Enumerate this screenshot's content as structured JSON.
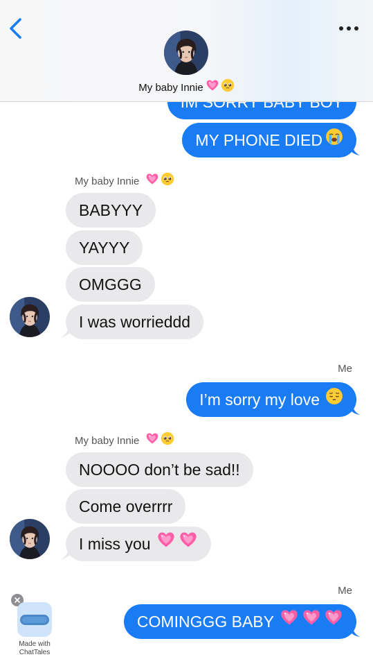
{
  "header": {
    "contact_name": "My baby Innie",
    "back_icon": "chevron-left-icon",
    "more_icon": "more-dots-icon"
  },
  "messages": [
    {
      "id": "m1",
      "side": "out",
      "text": "IM SORRY BABY BOY",
      "emojis": []
    },
    {
      "id": "m2",
      "side": "out",
      "text": "MY PHONE DIED",
      "emojis": [
        "crying-face-emoji"
      ]
    },
    {
      "id": "n1",
      "sender": "My baby Innie",
      "emojis": [
        "pink-heart-emoji",
        "pleading-face-emoji"
      ]
    },
    {
      "id": "m3",
      "side": "in",
      "text": "BABYYY"
    },
    {
      "id": "m4",
      "side": "in",
      "text": "YAYYY"
    },
    {
      "id": "m5",
      "side": "in",
      "text": "OMGGG"
    },
    {
      "id": "m6",
      "side": "in",
      "text": "I was worrieddd"
    },
    {
      "id": "n2",
      "sender": "Me"
    },
    {
      "id": "m7",
      "side": "out",
      "text": "I’m sorry my love",
      "emojis": [
        "pensive-face-emoji"
      ]
    },
    {
      "id": "n3",
      "sender": "My baby Innie",
      "emojis": [
        "pink-heart-emoji",
        "pleading-face-emoji"
      ]
    },
    {
      "id": "m8",
      "side": "in",
      "text": "NOOOO don’t be sad!!"
    },
    {
      "id": "m9",
      "side": "in",
      "text": "Come overrrr"
    },
    {
      "id": "m10",
      "side": "in",
      "text": "I miss you",
      "emojis": [
        "pink-heart-emoji",
        "pink-heart-emoji"
      ]
    },
    {
      "id": "n4",
      "sender": "Me"
    },
    {
      "id": "m11",
      "side": "out",
      "text": "COMINGGG BABY",
      "emojis": [
        "pink-heart-emoji",
        "pink-heart-emoji",
        "pink-heart-emoji"
      ]
    }
  ],
  "watermark": {
    "line1": "Made with",
    "line2": "ChatTales"
  },
  "colors": {
    "outgoing_bubble": "#1a7cf4",
    "incoming_bubble": "#e9e9eb",
    "accent": "#1a7cf4"
  }
}
